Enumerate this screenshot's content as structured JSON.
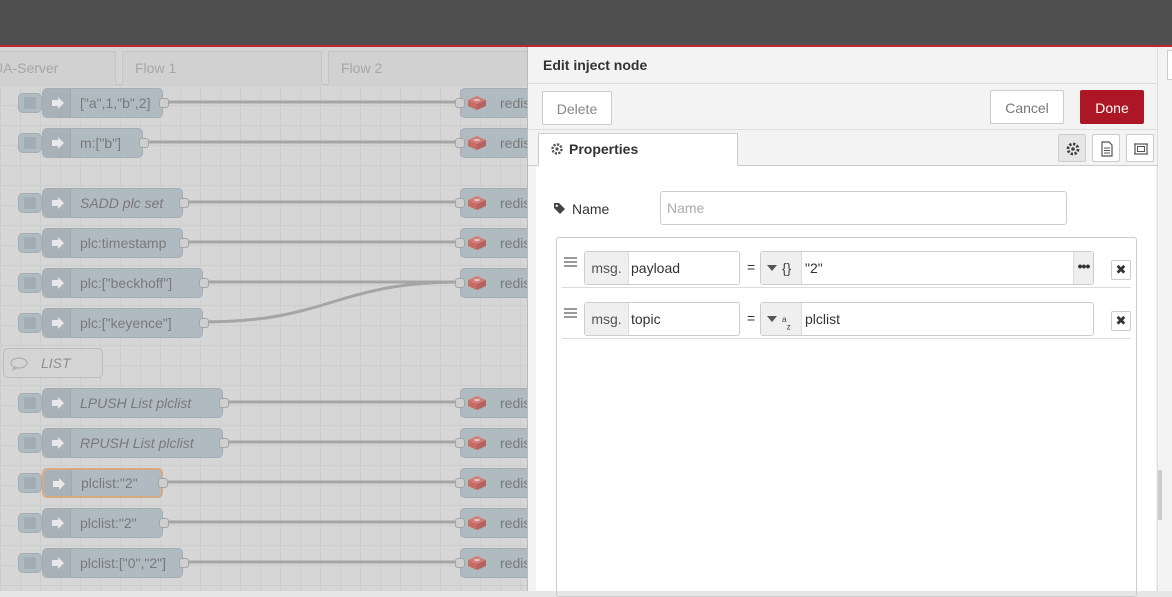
{
  "workspace": {
    "tabs": [
      "UA-Server",
      "Flow 1",
      "Flow 2"
    ],
    "nodes": [
      "[\"a\",1,\"b\",2]",
      "m:[\"b\"]",
      "SADD plc set",
      "plc:timestamp",
      "plc:[\"beckhoff\"]",
      "plc:[\"keyence\"]",
      "LPUSH List plclist",
      "RPUSH List plclist",
      "plclist:\"2\"",
      "plclist:\"2\"",
      "plclist:[\"0\",\"2\"]"
    ],
    "redis_label": "redis",
    "comment": "LIST"
  },
  "tray": {
    "title": "Edit inject node",
    "delete_label": "Delete",
    "cancel_label": "Cancel",
    "done_label": "Done",
    "properties_tab": "Properties",
    "name_label": "Name",
    "name_placeholder": "Name",
    "rows": [
      {
        "prefix": "msg.",
        "property": "payload",
        "eq": "=",
        "type_icon": "{}",
        "value": "\"2\"",
        "expand": "•••"
      },
      {
        "prefix": "msg.",
        "property": "topic",
        "eq": "=",
        "type_icon": "az",
        "value": "plclist"
      }
    ],
    "remove_label": "✖"
  },
  "colors": {
    "header": "#4f4f4f",
    "accent": "#ad1625",
    "node": "#aab8c4",
    "selected_border": "#e3a064",
    "redis_icon": "#d9534f"
  }
}
